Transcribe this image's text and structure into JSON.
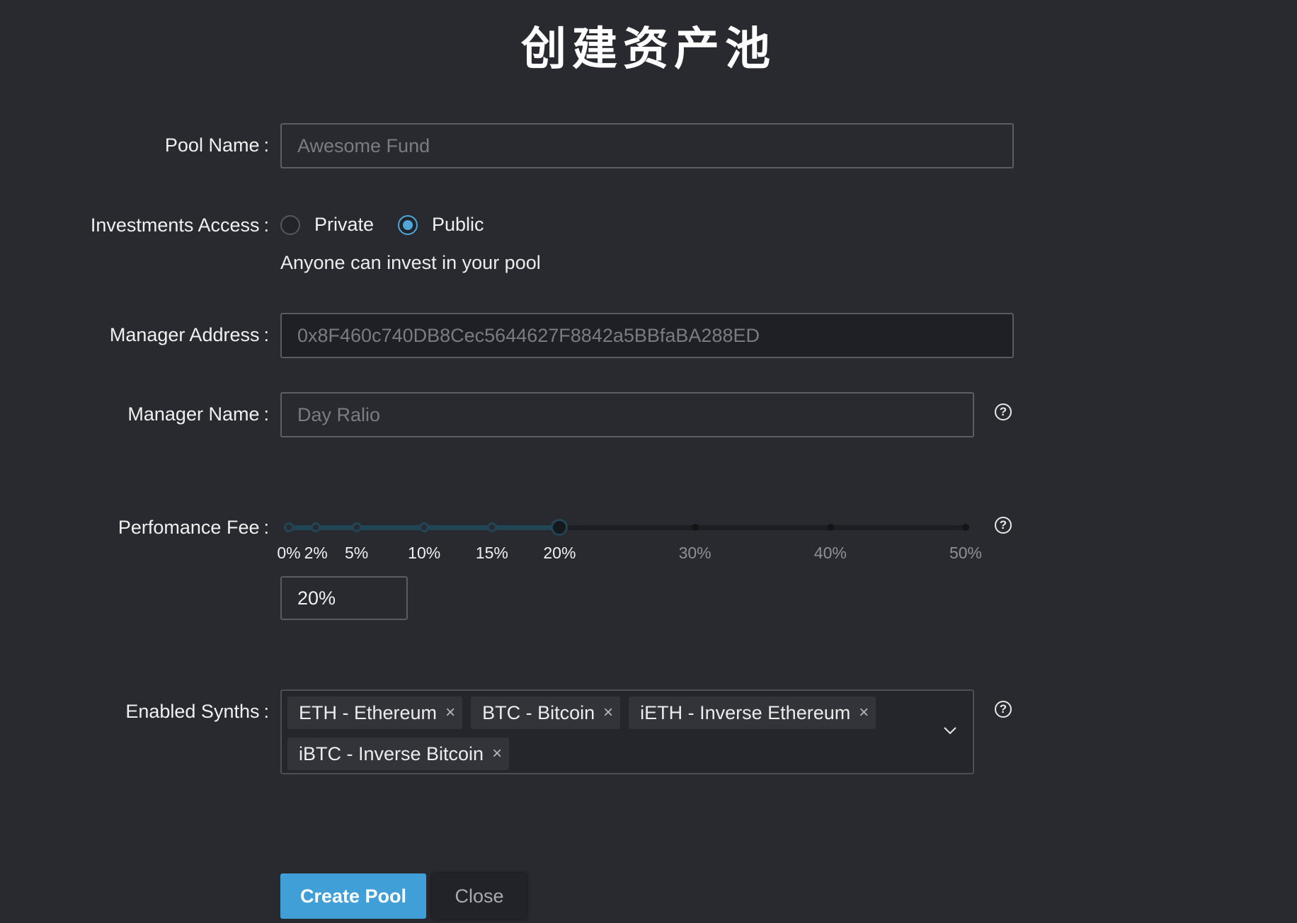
{
  "page": {
    "title": "创建资产池"
  },
  "form": {
    "pool_name": {
      "label": "Pool Name",
      "placeholder": "Awesome Fund",
      "value": ""
    },
    "access": {
      "label": "Investments Access",
      "options": [
        {
          "label": "Private",
          "checked": false
        },
        {
          "label": "Public",
          "checked": true
        }
      ],
      "hint": "Anyone can invest in your pool"
    },
    "manager_address": {
      "label": "Manager Address",
      "placeholder": "0x8F460c740DB8Cec5644627F8842a5BBfaBA288ED",
      "value": ""
    },
    "manager_name": {
      "label": "Manager Name",
      "placeholder": "Day Ralio",
      "value": ""
    },
    "fee": {
      "label": "Perfomance Fee",
      "marks": [
        "0%",
        "2%",
        "5%",
        "10%",
        "15%",
        "20%",
        "30%",
        "40%",
        "50%"
      ],
      "mark_values": [
        0,
        2,
        5,
        10,
        15,
        20,
        30,
        40,
        50
      ],
      "max": 50,
      "value": 20,
      "display": "20%"
    },
    "synths": {
      "label": "Enabled Synths",
      "tags": [
        "ETH - Ethereum",
        "BTC - Bitcoin",
        "iETH - Inverse Ethereum",
        "iBTC - Inverse Bitcoin"
      ],
      "remove_glyph": "×"
    },
    "colon": ":"
  },
  "buttons": {
    "create": "Create Pool",
    "close": "Close"
  },
  "icons": {
    "help": "?",
    "help_name": "question-circle-icon",
    "chevron_name": "chevron-down-icon",
    "remove_name": "close-icon"
  },
  "colors": {
    "background": "#292a30",
    "accent": "#3f9fd6",
    "slider_track": "#224556",
    "radio_checked": "#4fa6d9"
  }
}
